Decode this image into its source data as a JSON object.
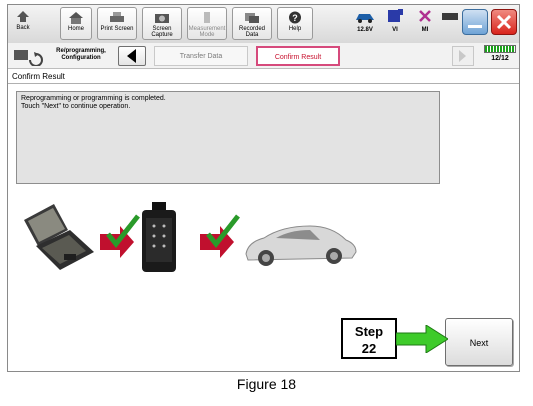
{
  "toolbar": {
    "back_label": "Back",
    "home_label": "Home",
    "print_label": "Print Screen",
    "capture_label": "Screen Capture",
    "measure_label": "Measurement Mode",
    "recorded_label": "Recorded Data",
    "help_label": "Help"
  },
  "status": {
    "voltage": "12.8V",
    "vi_label": "VI",
    "mi_label": "MI"
  },
  "breadcrumb": {
    "section_label": "Re/programming, Configuration",
    "steps": [
      {
        "label": "Transfer Data",
        "state": "inactive"
      },
      {
        "label": "Confirm Result",
        "state": "active"
      }
    ],
    "progress_text": "12/12",
    "progress_fraction": 1.0
  },
  "screen": {
    "title": "Confirm Result",
    "message_line1": "Reprogramming or programming is completed.",
    "message_line2": "Touch \"Next\" to continue operation."
  },
  "illustration": {
    "items": [
      "laptop-icon",
      "checkmark-arrow-icon",
      "vi-interface-icon",
      "checkmark-arrow-icon",
      "car-icon"
    ]
  },
  "annotation": {
    "step_word": "Step",
    "step_number": "22"
  },
  "next_button_label": "Next",
  "caption": "Figure 18",
  "colors": {
    "active_step_border": "#d64a7c",
    "active_step_text": "#c8102e",
    "progress_green": "#1aa11a",
    "arrow_green": "#3ecb2a",
    "close_red": "#d9241c",
    "minimize_blue": "#6fa3d6"
  }
}
